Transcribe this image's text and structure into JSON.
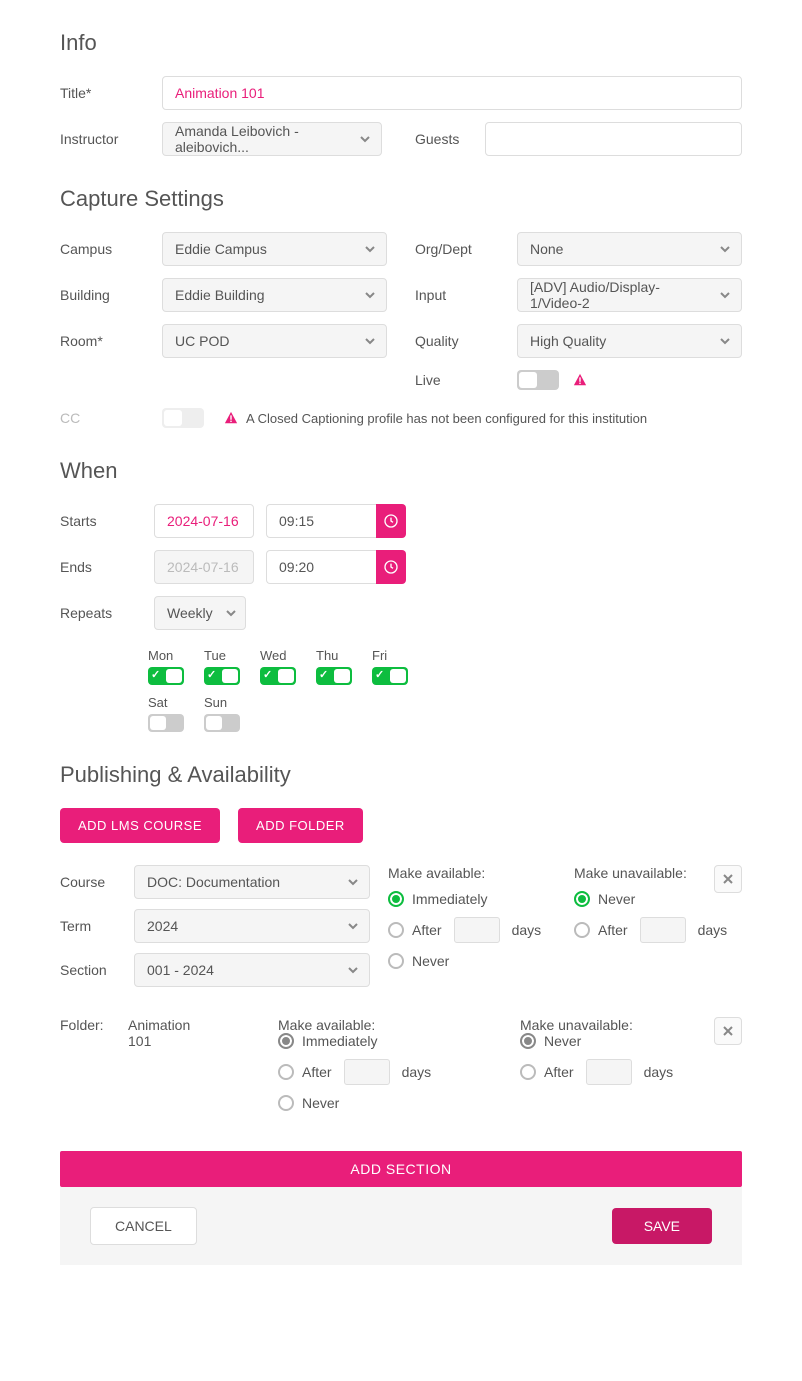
{
  "info": {
    "heading": "Info",
    "title_label": "Title*",
    "title_value": "Animation 101",
    "instructor_label": "Instructor",
    "instructor_value": "Amanda Leibovich - aleibovich...",
    "guests_label": "Guests",
    "guests_value": ""
  },
  "capture": {
    "heading": "Capture Settings",
    "campus_label": "Campus",
    "campus_value": "Eddie Campus",
    "building_label": "Building",
    "building_value": "Eddie Building",
    "room_label": "Room*",
    "room_value": "UC POD",
    "orgdept_label": "Org/Dept",
    "orgdept_value": "None",
    "input_label": "Input",
    "input_value": "[ADV] Audio/Display-1/Video-2",
    "quality_label": "Quality",
    "quality_value": "High Quality",
    "live_label": "Live",
    "cc_label": "CC",
    "cc_warning": "A Closed Captioning profile has not been configured for this institution"
  },
  "when": {
    "heading": "When",
    "starts_label": "Starts",
    "starts_date": "2024-07-16",
    "starts_time": "09:15",
    "ends_label": "Ends",
    "ends_date": "2024-07-16",
    "ends_time": "09:20",
    "repeats_label": "Repeats",
    "repeats_value": "Weekly",
    "days": {
      "mon": "Mon",
      "tue": "Tue",
      "wed": "Wed",
      "thu": "Thu",
      "fri": "Fri",
      "sat": "Sat",
      "sun": "Sun"
    }
  },
  "publishing": {
    "heading": "Publishing & Availability",
    "add_lms": "ADD LMS COURSE",
    "add_folder": "ADD FOLDER",
    "course_label": "Course",
    "course_value": "DOC: Documentation",
    "term_label": "Term",
    "term_value": "2024",
    "section_label": "Section",
    "section_value": "001 - 2024",
    "make_available": "Make available:",
    "make_unavailable": "Make unavailable:",
    "immediately": "Immediately",
    "after": "After",
    "days_suffix": "days",
    "never": "Never",
    "folder_label": "Folder:",
    "folder_name": "Animation 101"
  },
  "actions": {
    "add_section": "ADD SECTION",
    "cancel": "CANCEL",
    "save": "SAVE"
  }
}
